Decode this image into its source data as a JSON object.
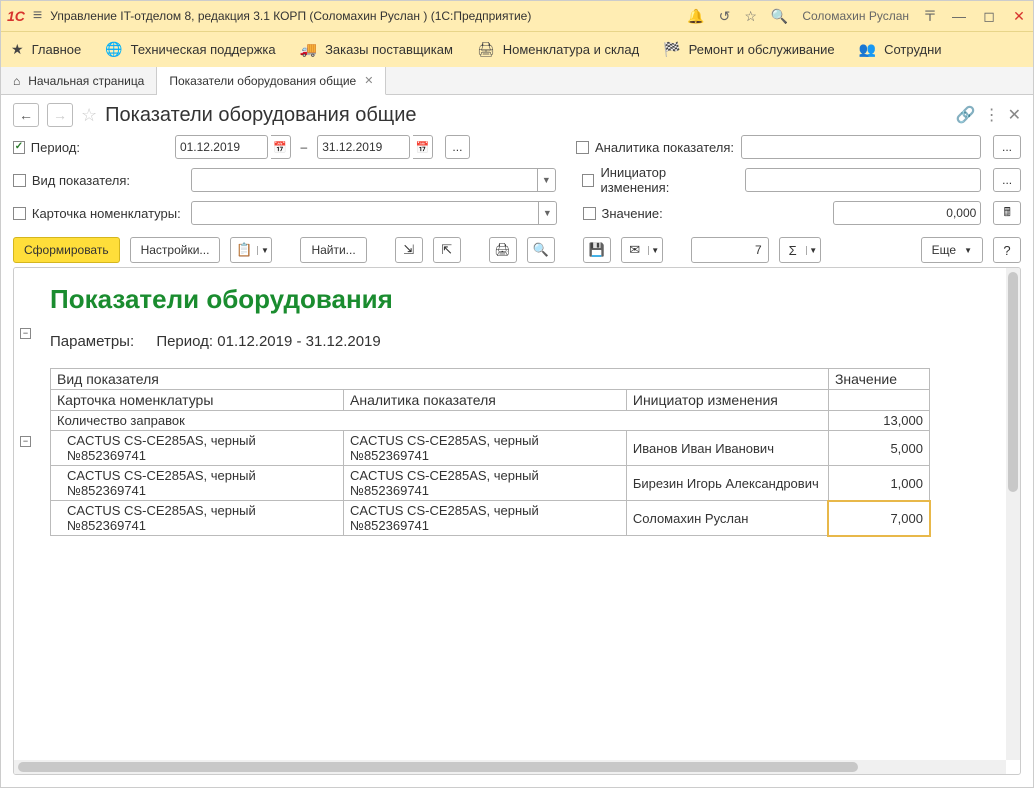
{
  "titlebar": {
    "app_title": "Управление IT-отделом 8, редакция 3.1 КОРП (Соломахин Руслан )  (1С:Предприятие)",
    "user": "Соломахин Руслан"
  },
  "nav": {
    "items": [
      {
        "icon": "star",
        "label": "Главное"
      },
      {
        "icon": "globe",
        "label": "Техническая поддержка"
      },
      {
        "icon": "truck",
        "label": "Заказы поставщикам"
      },
      {
        "icon": "printer",
        "label": "Номенклатура и склад"
      },
      {
        "icon": "flag",
        "label": "Ремонт и обслуживание"
      },
      {
        "icon": "users",
        "label": "Сотрудни"
      }
    ]
  },
  "tabs": {
    "home": "Начальная страница",
    "active": "Показатели оборудования общие"
  },
  "page": {
    "title": "Показатели оборудования общие"
  },
  "filters": {
    "period_label": "Период:",
    "date_from": "01.12.2019",
    "date_to": "31.12.2019",
    "type_label": "Вид показателя:",
    "card_label": "Карточка номенклатуры:",
    "analytics_label": "Аналитика показателя:",
    "initiator_label": "Инициатор изменения:",
    "value_label": "Значение:",
    "value_value": "0,000"
  },
  "toolbar": {
    "generate": "Сформировать",
    "settings": "Настройки...",
    "find": "Найти...",
    "input_val": "7",
    "more": "Еще",
    "help": "?"
  },
  "report": {
    "title": "Показатели оборудования",
    "params_label": "Параметры:",
    "params_value": "Период: 01.12.2019 - 31.12.2019",
    "headers": {
      "type": "Вид показателя",
      "value": "Значение",
      "card": "Карточка номенклатуры",
      "analytics": "Аналитика показателя",
      "initiator": "Инициатор изменения"
    },
    "group": {
      "name": "Количество заправок",
      "value": "13,000"
    },
    "rows": [
      {
        "card": "CACTUS CS-CE285AS, черный №852369741",
        "analytics": "CACTUS CS-CE285AS, черный №852369741",
        "initiator": "Иванов Иван Иванович",
        "value": "5,000"
      },
      {
        "card": "CACTUS CS-CE285AS, черный №852369741",
        "analytics": "CACTUS CS-CE285AS, черный №852369741",
        "initiator": "Бирезин Игорь Александрович",
        "value": "1,000"
      },
      {
        "card": "CACTUS CS-CE285AS, черный №852369741",
        "analytics": "CACTUS CS-CE285AS, черный №852369741",
        "initiator": "Соломахин Руслан",
        "value": "7,000"
      }
    ]
  }
}
